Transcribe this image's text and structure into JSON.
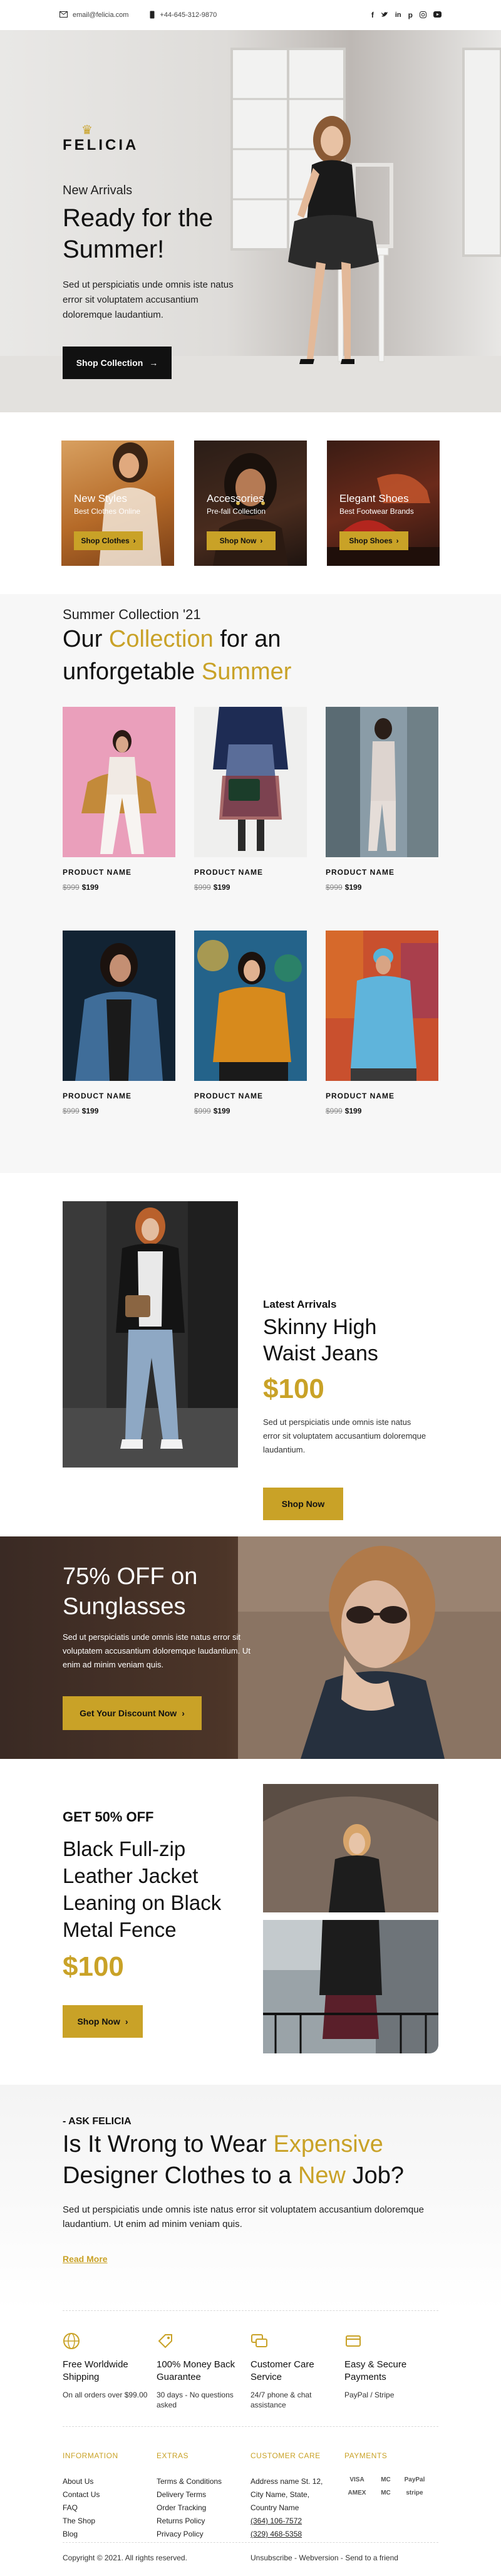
{
  "topbar": {
    "email": "email@felicia.com",
    "phone": "+44-645-312-9870",
    "social": [
      "facebook-icon",
      "twitter-icon",
      "linkedin-icon",
      "pinterest-icon",
      "instagram-icon",
      "youtube-icon"
    ]
  },
  "hero": {
    "logo": "FELICIA",
    "eyebrow": "New Arrivals",
    "title": "Ready for the Summer!",
    "text": "Sed ut perspiciatis unde omnis iste natus error sit voluptatem accusantium doloremque laudantium.",
    "button": "Shop Collection"
  },
  "categories": [
    {
      "title": "New Styles",
      "subtitle": "Best Clothes Online",
      "button": "Shop Clothes"
    },
    {
      "title": "Accessories",
      "subtitle": "Pre-fall Collection",
      "button": "Shop Now"
    },
    {
      "title": "Elegant Shoes",
      "subtitle": "Best Footwear Brands",
      "button": "Shop Shoes"
    }
  ],
  "collection": {
    "subtitle": "Summer Collection '21",
    "title_1": "Our ",
    "title_2": "Collection",
    "title_3": " for an unforgetable ",
    "title_4": "Summer",
    "products": [
      {
        "name": "PRODUCT NAME",
        "old": "$999",
        "price": "$199"
      },
      {
        "name": "PRODUCT NAME",
        "old": "$999",
        "price": "$199"
      },
      {
        "name": "PRODUCT NAME",
        "old": "$999",
        "price": "$199"
      },
      {
        "name": "PRODUCT NAME",
        "old": "$999",
        "price": "$199"
      },
      {
        "name": "PRODUCT NAME",
        "old": "$999",
        "price": "$199"
      },
      {
        "name": "PRODUCT NAME",
        "old": "$999",
        "price": "$199"
      }
    ]
  },
  "jeans": {
    "kicker": "Latest Arrivals",
    "title": "Skinny High Waist Jeans",
    "price": "$100",
    "text": "Sed ut perspiciatis unde omnis iste natus error sit voluptatem accusantium doloremque laudantium.",
    "button": "Shop Now"
  },
  "sunglasses": {
    "title": "75% OFF on Sunglasses",
    "text": "Sed ut perspiciatis unde omnis iste natus error sit voluptatem accusantium doloremque laudantium. Ut enim ad minim veniam quis.",
    "button": "Get Your Discount Now"
  },
  "leather": {
    "kicker": "GET 50% OFF",
    "title": "Black Full-zip Leather Jacket Leaning on Black Metal Fence",
    "price": "$100",
    "button": "Shop Now"
  },
  "ask": {
    "kicker": "- ASK FELICIA",
    "title_1": "Is It Wrong to Wear ",
    "title_2": "Expensive",
    "title_3": " Designer Clothes to a ",
    "title_4": "New",
    "title_5": " Job?",
    "text": "Sed ut perspiciatis unde omnis iste natus error sit voluptatem accusantium doloremque laudantium. Ut enim ad minim veniam quis.",
    "link": "Read More"
  },
  "features": [
    {
      "icon": "globe-icon",
      "title": "Free Worldwide Shipping",
      "sub": "On all orders over $99.00"
    },
    {
      "icon": "tag-icon",
      "title": "100% Money Back Guarantee",
      "sub": "30 days - No questions asked"
    },
    {
      "icon": "chat-icon",
      "title": "Customer Care Service",
      "sub": "24/7 phone & chat assistance"
    },
    {
      "icon": "card-icon",
      "title": "Easy & Secure Payments",
      "sub": "PayPal / Stripe"
    }
  ],
  "footer": {
    "information": {
      "heading": "INFORMATION",
      "items": [
        "About Us",
        "Contact Us",
        "FAQ",
        "The Shop",
        "Blog"
      ]
    },
    "extras": {
      "heading": "EXTRAS",
      "items": [
        "Terms & Conditions",
        "Delivery Terms",
        "Order Tracking",
        "Returns Policy",
        "Privacy Policy"
      ]
    },
    "care": {
      "heading": "CUSTOMER CARE",
      "items": [
        "Address name St. 12,",
        "City Name, State,",
        "Country Name",
        "(364) 106-7572",
        "(329) 468-5358"
      ]
    },
    "payments": {
      "heading": "PAYMENTS",
      "items": [
        "VISA",
        "MC",
        "PayPal",
        "AMEX",
        "MC",
        "stripe"
      ]
    },
    "copyright": "Copyright © 2021. All rights reserved.",
    "unsubscribe": "Unsubscribe",
    "webversion": "Webversion",
    "send": "Send to a friend",
    "sep": " - "
  }
}
